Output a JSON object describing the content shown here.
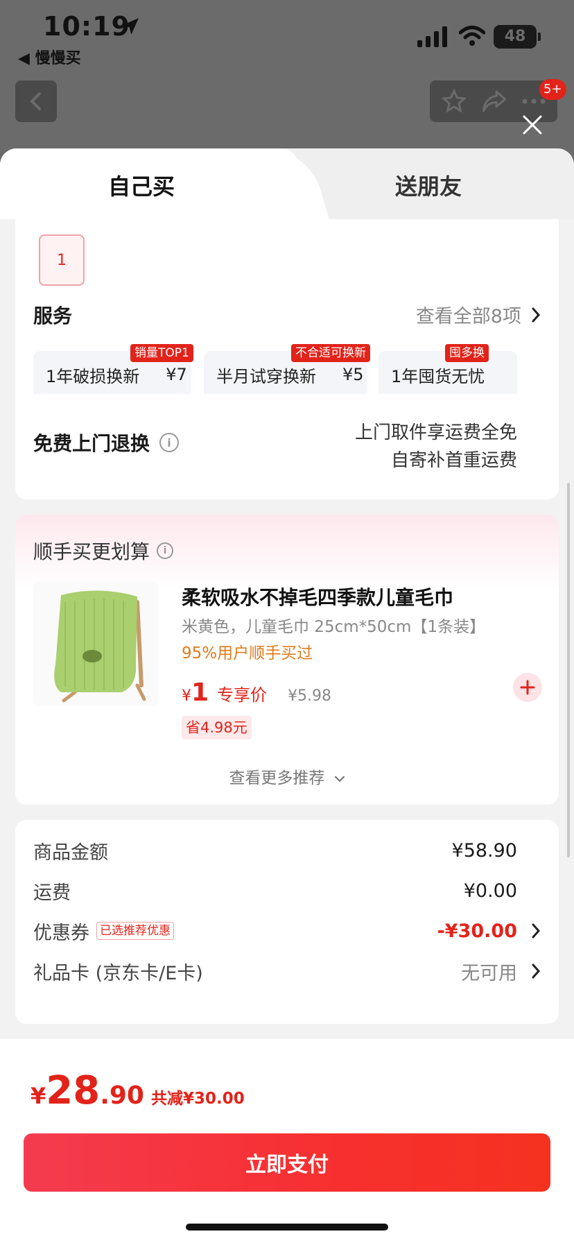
{
  "status_bar": {
    "time": "10:19",
    "back_app": "◀ 慢慢买",
    "battery": "48"
  },
  "nav": {
    "badge": "5+"
  },
  "tabs": [
    {
      "label": "自己买"
    },
    {
      "label": "送朋友"
    }
  ],
  "quantity": "1",
  "services": {
    "title": "服务",
    "view_all": "查看全部8项",
    "items": [
      {
        "name": "1年破损换新",
        "price": "¥7",
        "tag": "销量TOP1"
      },
      {
        "name": "半月试穿换新",
        "price": "¥5",
        "tag": "不合适可换新"
      },
      {
        "name": "1年囤货无忧",
        "price": "",
        "tag": "囤多换"
      }
    ]
  },
  "free_return": {
    "title": "免费上门退换",
    "line1": "上门取件享运费全免",
    "line2": "自寄补首重运费"
  },
  "recommend": {
    "title": "顺手买更划算",
    "product_name": "柔软吸水不掉毛四季款儿童毛巾",
    "spec": "米黄色，儿童毛巾 25cm*50cm【1条装】",
    "percent": "95%用户顺手买过",
    "price_symbol": "¥",
    "price": "1",
    "price_label": "专享价",
    "orig_price": "¥5.98",
    "save": "省4.98元",
    "more": "查看更多推荐"
  },
  "summary": {
    "goods_label": "商品金额",
    "goods_value": "¥58.90",
    "shipping_label": "运费",
    "shipping_value": "¥0.00",
    "coupon_label": "优惠券",
    "coupon_tag": "已选推荐优惠",
    "coupon_value": "-¥30.00",
    "gift_label": "礼品卡 (京东卡/E卡)",
    "gift_value": "无可用"
  },
  "footer": {
    "currency": "¥",
    "total_int": "28",
    "total_dec": ".90",
    "saved": "共减¥30.00",
    "pay_label": "立即支付"
  },
  "colors": {
    "accent": "#e2231a",
    "orange": "#e07b1a",
    "towel": "#a9cf6e"
  }
}
